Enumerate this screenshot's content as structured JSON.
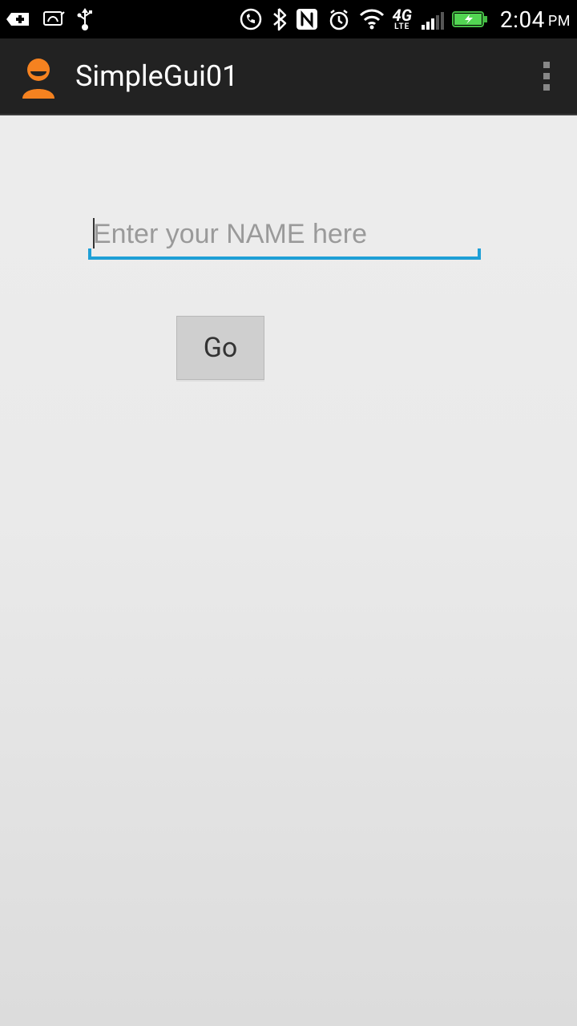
{
  "status_bar": {
    "time": "2:04",
    "ampm": "PM",
    "network_label": "4G",
    "network_sublabel": "LTE"
  },
  "action_bar": {
    "title": "SimpleGui01"
  },
  "form": {
    "name_placeholder": "Enter your NAME here",
    "name_value": "",
    "go_label": "Go"
  },
  "colors": {
    "accent": "#1e9fd6",
    "app_icon": "#f58220"
  }
}
